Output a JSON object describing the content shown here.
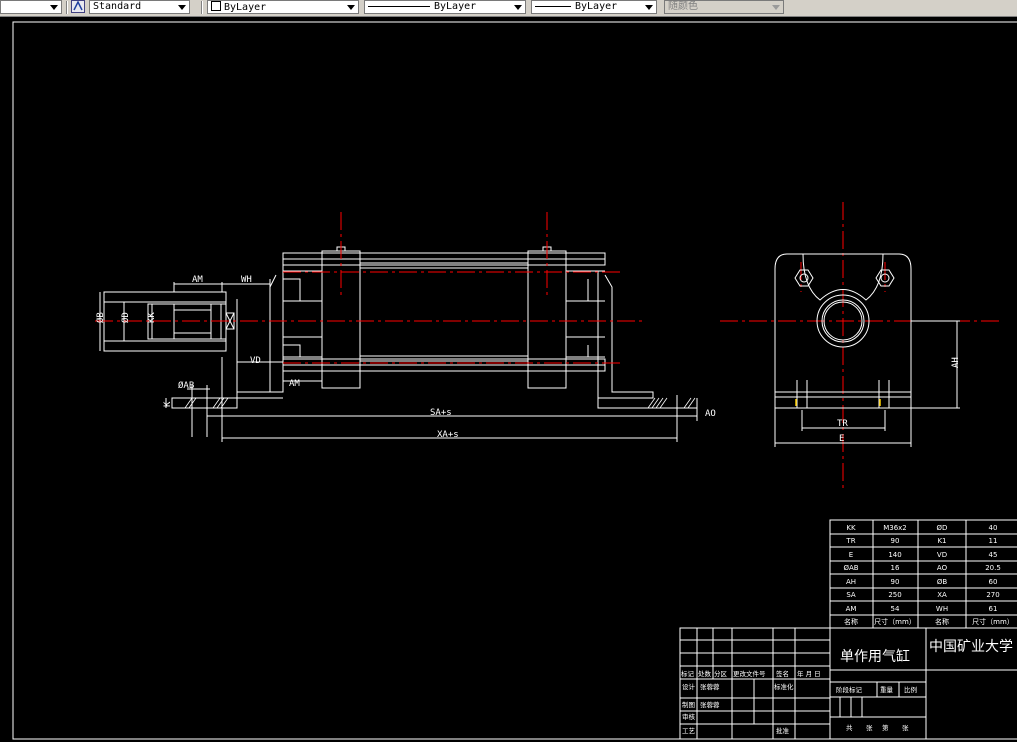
{
  "toolbar": {
    "text_style": "Standard",
    "color": "ByLayer",
    "linetype": "ByLayer",
    "lineweight": "ByLayer",
    "plotstyle": "随颜色"
  },
  "colors": {
    "model_lines": "#ffffff",
    "center_lines": "#ff0000",
    "background": "#000000"
  },
  "dimensions": {
    "side_view": [
      "AM",
      "WH",
      "ØB",
      "ØD",
      "KK",
      "VD",
      "AM",
      "ØAB",
      "K",
      "SA+s",
      "AO",
      "XA+s"
    ],
    "end_view": [
      "AH",
      "TR",
      "E"
    ]
  },
  "param_table": {
    "rows": [
      [
        "KK",
        "M36x2",
        "ØD",
        "40"
      ],
      [
        "TR",
        "90",
        "K1",
        "11"
      ],
      [
        "E",
        "140",
        "VD",
        "45"
      ],
      [
        "ØAB",
        "16",
        "AO",
        "20.5"
      ],
      [
        "AH",
        "90",
        "ØB",
        "60"
      ],
      [
        "SA",
        "250",
        "XA",
        "270"
      ],
      [
        "AM",
        "54",
        "WH",
        "61"
      ]
    ],
    "footer": [
      "名称",
      "尺寸（mm）",
      "名称",
      "尺寸（mm）"
    ]
  },
  "title_block": {
    "title": "单作用气缸",
    "institution": "中国矿业大学",
    "rev_header": [
      "标记",
      "处数",
      "分区",
      "更改文件号",
      "签名",
      "年 月 日"
    ],
    "design_row": [
      "设计",
      "张蓉蓉",
      "标准化"
    ],
    "drawn_row": [
      "制图",
      "张蓉蓉"
    ],
    "check_row": [
      "审核"
    ],
    "process_row": [
      "工艺",
      "批准"
    ],
    "stage_label": "阶段标记",
    "weight_label": "重量",
    "scale_label": "比例",
    "sheets": [
      "共",
      "张",
      "第",
      "张"
    ]
  }
}
